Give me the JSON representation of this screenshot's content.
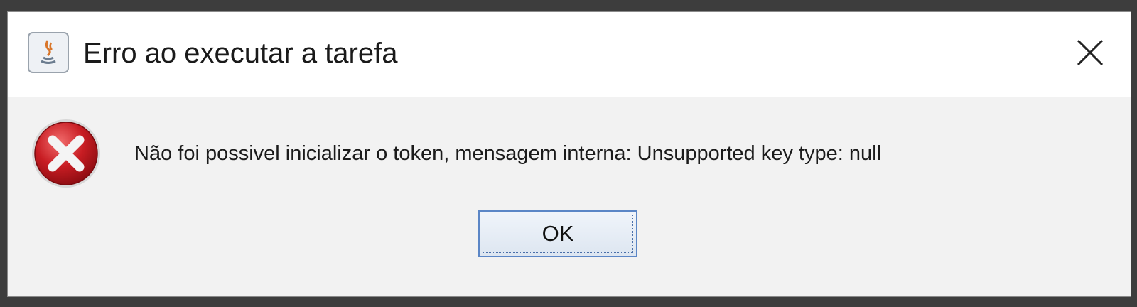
{
  "window": {
    "title": "Erro ao executar a tarefa",
    "app_icon": "java-icon",
    "close_icon": "close-icon"
  },
  "dialog": {
    "icon": "error-icon",
    "message": "Não foi possivel inicializar o token, mensagem interna: Unsupported key type: null",
    "ok_label": "OK"
  },
  "colors": {
    "error_red": "#c0141c",
    "button_border": "#5b86c6",
    "titlebar_bg": "#ffffff",
    "content_bg": "#f2f2f2"
  }
}
